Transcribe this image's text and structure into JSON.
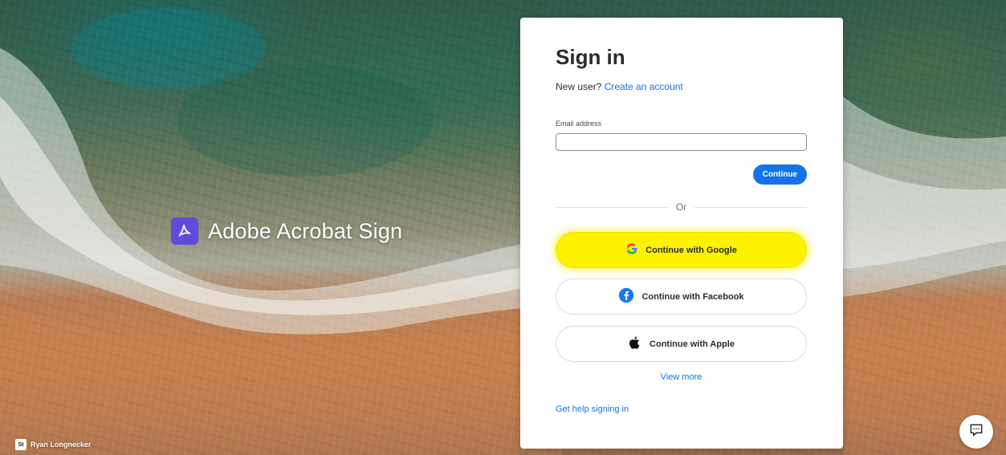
{
  "brand": {
    "name": "Adobe Acrobat Sign",
    "logo_color": "#5f4bdc"
  },
  "photo_credit": {
    "badge": "St",
    "author": "Ryan Longnecker"
  },
  "signin": {
    "title": "Sign in",
    "new_user_prompt": "New user?",
    "create_account_link": "Create an account",
    "email_label": "Email address",
    "email_value": "",
    "continue_label": "Continue",
    "divider_text": "Or",
    "google_label": "Continue with Google",
    "facebook_label": "Continue with Facebook",
    "apple_label": "Continue with Apple",
    "view_more_label": "View more",
    "help_link": "Get help signing in"
  },
  "icons": {
    "brand": "acrobat-logo-icon",
    "google": "google-icon",
    "facebook": "facebook-icon",
    "apple": "apple-icon",
    "chat": "chat-icon"
  },
  "colors": {
    "accent": "#1473e6",
    "highlight": "#fff200",
    "facebook": "#1877f2"
  }
}
